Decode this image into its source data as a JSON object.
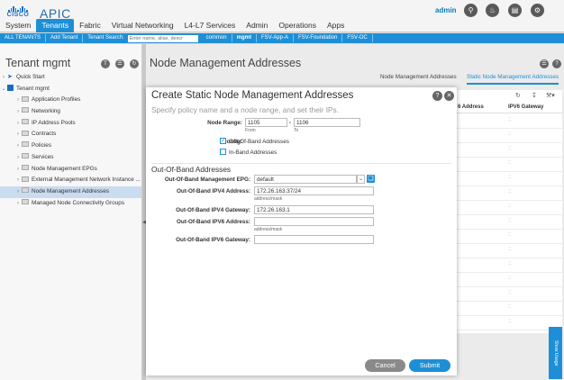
{
  "header": {
    "logo_text": "CISCO",
    "app_title": "APIC",
    "user": "admin",
    "tabs": [
      "System",
      "Tenants",
      "Fabric",
      "Virtual Networking",
      "L4-L7 Services",
      "Admin",
      "Operations",
      "Apps"
    ],
    "active_tab": "Tenants"
  },
  "subnav": {
    "all_tenants": "ALL TENANTS",
    "add_tenant": "Add Tenant",
    "search_label": "Tenant Search:",
    "search_placeholder": "Enter name, alias, descr",
    "tenants": [
      "common",
      "mgmt",
      "FSV-App-A",
      "FSV-Foundation",
      "FSV-OC"
    ]
  },
  "left_panel": {
    "title": "Tenant mgmt",
    "quick_start": "Quick Start",
    "tenant_root": "Tenant mgmt",
    "items": [
      "Application Profiles",
      "Networking",
      "IP Address Pools",
      "Contracts",
      "Policies",
      "Services",
      "Node Management EPGs",
      "External Management Network Instance ...",
      "Node Management Addresses",
      "Managed Node Connectivity Groups"
    ],
    "selected": "Node Management Addresses"
  },
  "main_panel": {
    "title": "Node Management Addresses",
    "tabs": [
      "Node Management Addresses",
      "Static Node Management Addresses"
    ],
    "active_tab": "Static Node Management Addresses",
    "columns": [
      "6 Address",
      "IPV6 Gateway"
    ],
    "row_placeholder": "::",
    "side_tab": "Show Usage"
  },
  "modal": {
    "title": "Create Static Node Management Addresses",
    "subtitle": "Specify policy name and a node range, and set their IPs.",
    "node_range_label": "Node Range:",
    "node_from": "1105",
    "node_from_hint": "From",
    "node_to": "1106",
    "node_to_hint": "To",
    "range_sep": "-",
    "config_label": "Config:",
    "oob_option": "Out-Of-Band Addresses",
    "inband_option": "In-Band Addresses",
    "section_title": "Out-Of-Band Addresses",
    "epg_label": "Out-Of-Band Management EPG:",
    "epg_value": "default",
    "ipv4_addr_label": "Out-Of-Band IPV4 Address:",
    "ipv4_addr_value": "172.26.163.37/24",
    "ipv4_hint": "address/mask",
    "ipv4_gw_label": "Out-Of-Band IPV4 Gateway:",
    "ipv4_gw_value": "172.26.163.1",
    "ipv6_addr_label": "Out-Of-Band IPV6 Address:",
    "ipv6_addr_value": "",
    "ipv6_hint": "address/mask",
    "ipv6_gw_label": "Out-Of-Band IPV6 Gateway:",
    "ipv6_gw_value": "",
    "cancel": "Cancel",
    "submit": "Submit"
  },
  "colors": {
    "accent": "#1e8fd6",
    "header_bg": "#f4f4f4",
    "cancel_bg": "#8a8a8a"
  }
}
